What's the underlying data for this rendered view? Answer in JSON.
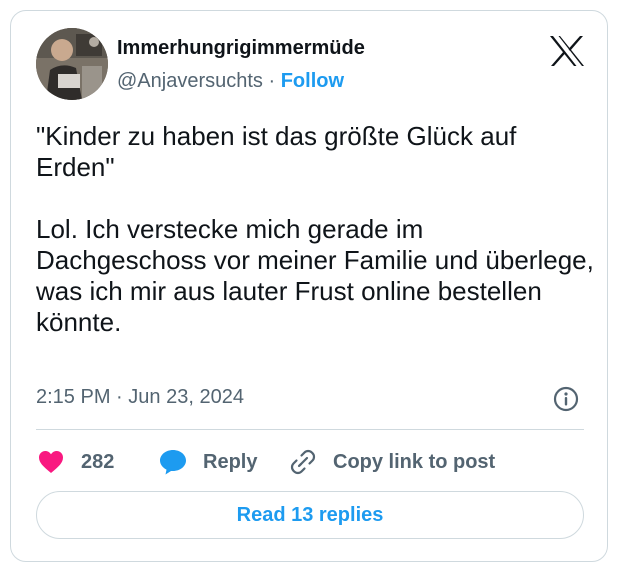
{
  "author": {
    "display_name": "Immerhungrigimmermüde",
    "handle": "@Anjaversuchts",
    "separator": "·",
    "follow_label": "Follow",
    "avatar_icon": "user-photo-avatar"
  },
  "platform_icon": "x-logo-icon",
  "tweet": {
    "text": "\"Kinder zu haben ist das größte Glück auf Erden\"\n\nLol. Ich verstecke mich gerade im Dachgeschoss vor meiner Familie und überlege, was ich mir aus lauter Frust online bestellen könnte.",
    "time": "2:15 PM",
    "separator": "·",
    "date": "Jun 23, 2024"
  },
  "actions": {
    "like_count": "282",
    "reply_label": "Reply",
    "copy_link_label": "Copy link to post"
  },
  "read_replies_label": "Read 13 replies",
  "colors": {
    "accent": "#1d9bf0",
    "like": "#f91880",
    "text": "#0f1419",
    "secondary": "#536471",
    "border": "#cfd9de"
  }
}
